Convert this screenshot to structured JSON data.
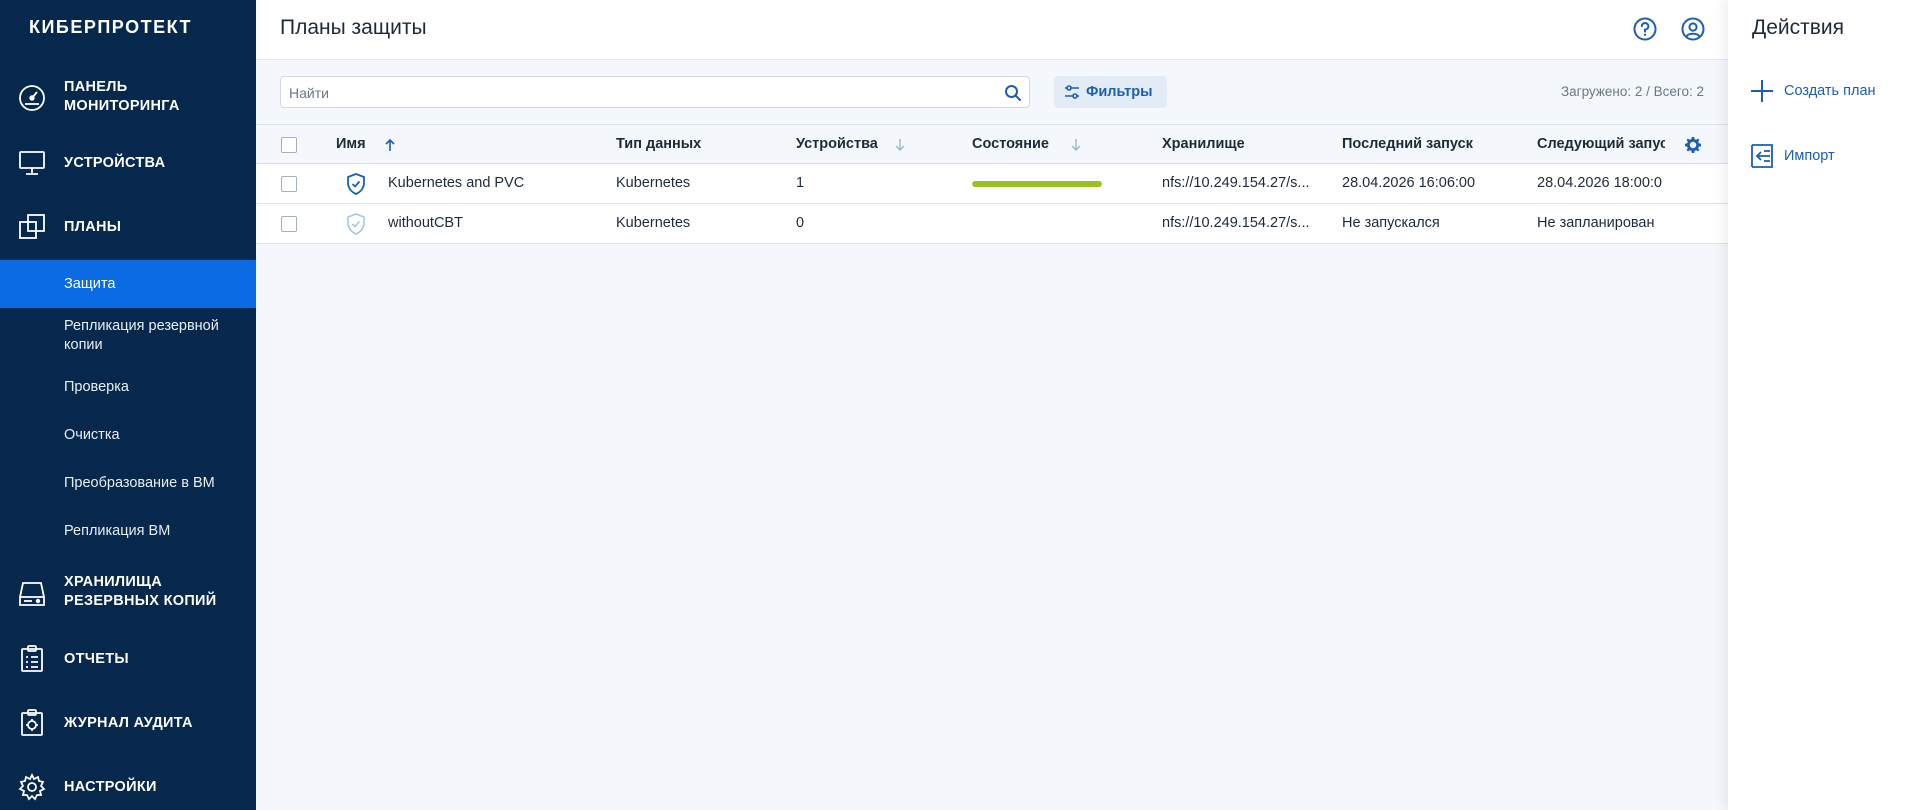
{
  "app": {
    "logo": "КИБЕРПРОТЕКТ"
  },
  "sidebar": {
    "items": [
      {
        "label": "ПАНЕЛЬ\nМОНИТОРИНГА",
        "icon": "dashboard-gauge-icon"
      },
      {
        "label": "УСТРОЙСТВА",
        "icon": "monitor-icon"
      },
      {
        "label": "ПЛАНЫ",
        "icon": "plans-icon"
      },
      {
        "label": "ХРАНИЛИЩА\nРЕЗЕРВНЫХ КОПИЙ",
        "icon": "storage-drive-icon"
      },
      {
        "label": "ОТЧЕТЫ",
        "icon": "report-clipboard-icon"
      },
      {
        "label": "ЖУРНАЛ АУДИТА",
        "icon": "audit-log-icon"
      },
      {
        "label": "НАСТРОЙКИ",
        "icon": "gear-icon"
      }
    ],
    "sub_items": [
      {
        "label": "Защита",
        "active": true
      },
      {
        "label": "Репликация резервной\nкопии",
        "active": false
      },
      {
        "label": "Проверка",
        "active": false
      },
      {
        "label": "Очистка",
        "active": false
      },
      {
        "label": "Преобразование в ВМ",
        "active": false
      },
      {
        "label": "Репликация ВМ",
        "active": false
      }
    ]
  },
  "header": {
    "title": "Планы защиты",
    "icons": [
      "help-icon",
      "user-account-icon"
    ]
  },
  "toolbar": {
    "search_placeholder": "Найти",
    "filter_label": "Фильтры",
    "loaded_text": "Загружено: 2 / Всего: 2"
  },
  "table": {
    "columns": [
      "Имя",
      "Тип данных",
      "Устройства",
      "Состояние",
      "Хранилище",
      "Последний запуск",
      "Следующий запус"
    ],
    "rows": [
      {
        "name": "Kubernetes and PVC",
        "type": "Kubernetes",
        "devices": "1",
        "state_progress": 1.0,
        "storage": "nfs://10.249.154.27/s...",
        "last_run": "28.04.2026 16:06:00",
        "next_run": "28.04.2026 18:00:0",
        "icon": "shield-check-icon",
        "icon_state": "active"
      },
      {
        "name": "withoutCBT",
        "type": "Kubernetes",
        "devices": "0",
        "state_progress": null,
        "storage": "nfs://10.249.154.27/s...",
        "last_run": "Не запускался",
        "next_run": "Не запланирован",
        "icon": "shield-check-icon",
        "icon_state": "inactive"
      }
    ]
  },
  "actions": {
    "title": "Действия",
    "items": [
      {
        "label": "Создать план",
        "icon": "plus-icon"
      },
      {
        "label": "Импорт",
        "icon": "import-icon"
      }
    ]
  },
  "colors": {
    "sidebar_bg": "#06284d",
    "active_item": "#0b6be3",
    "link_blue": "#1a5fb4",
    "progress_green": "#98c21f"
  }
}
